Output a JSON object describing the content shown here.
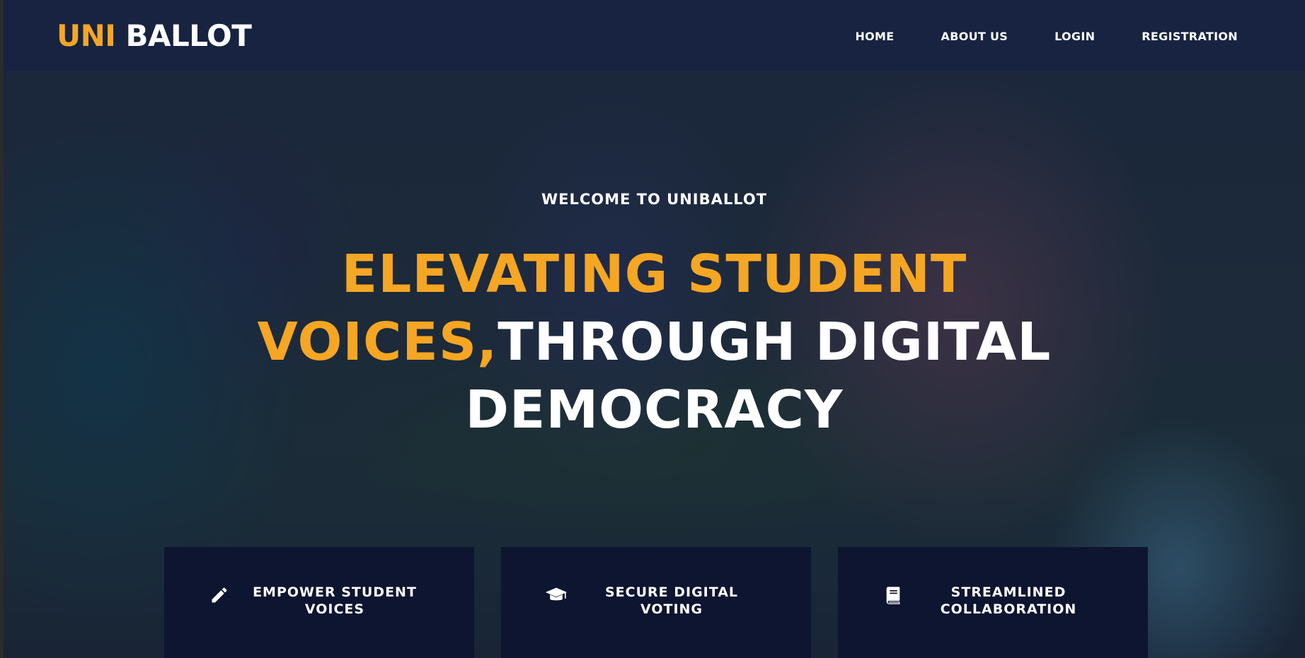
{
  "header": {
    "logo_part1": "UNI",
    "logo_part2": "BALLOT",
    "nav": [
      {
        "label": "HOME"
      },
      {
        "label": "ABOUT US"
      },
      {
        "label": "LOGIN"
      },
      {
        "label": "REGISTRATION"
      }
    ]
  },
  "hero": {
    "welcome": "WELCOME TO UNIBALLOT",
    "headline_highlight_1": "ELEVATING STUDENT",
    "headline_highlight_2": "VOICES,",
    "headline_rest_1": "THROUGH DIGITAL",
    "headline_rest_2": "DEMOCRACY"
  },
  "cards": [
    {
      "icon": "pencil-icon",
      "title": "EMPOWER STUDENT VOICES"
    },
    {
      "icon": "graduation-cap-icon",
      "title": "SECURE DIGITAL VOTING"
    },
    {
      "icon": "book-icon",
      "title": "STREAMLINED COLLABORATION"
    }
  ],
  "colors": {
    "accent": "#f5a623",
    "navbar": "#172340",
    "card": "#0d1530",
    "text": "#ffffff"
  }
}
